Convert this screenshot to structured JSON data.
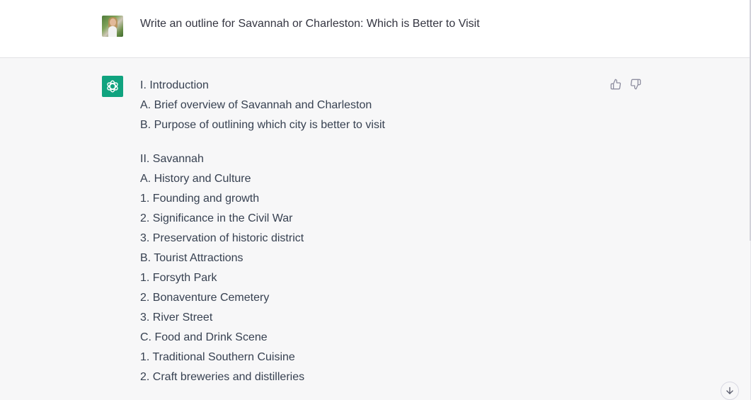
{
  "user_message": {
    "avatar": "user-avatar-photo",
    "text": "Write an outline for Savannah or Charleston: Which is Better to Visit"
  },
  "assistant_message": {
    "icon": "openai-logo-icon",
    "brand_color": "#10a37f",
    "blocks": [
      {
        "lines": [
          "I. Introduction",
          "A. Brief overview of Savannah and Charleston",
          "B. Purpose of outlining which city is better to visit"
        ]
      },
      {
        "lines": [
          "II. Savannah",
          "A. History and Culture",
          "1. Founding and growth",
          "2. Significance in the Civil War",
          "3. Preservation of historic district",
          "B. Tourist Attractions",
          "1. Forsyth Park",
          "2. Bonaventure Cemetery",
          "3. River Street",
          "C. Food and Drink Scene",
          "1. Traditional Southern Cuisine",
          "2. Craft breweries and distilleries"
        ]
      }
    ],
    "feedback": {
      "thumbs_up": "thumbs-up-icon",
      "thumbs_down": "thumbs-down-icon"
    }
  },
  "scroll_down": {
    "icon": "arrow-down-icon"
  }
}
